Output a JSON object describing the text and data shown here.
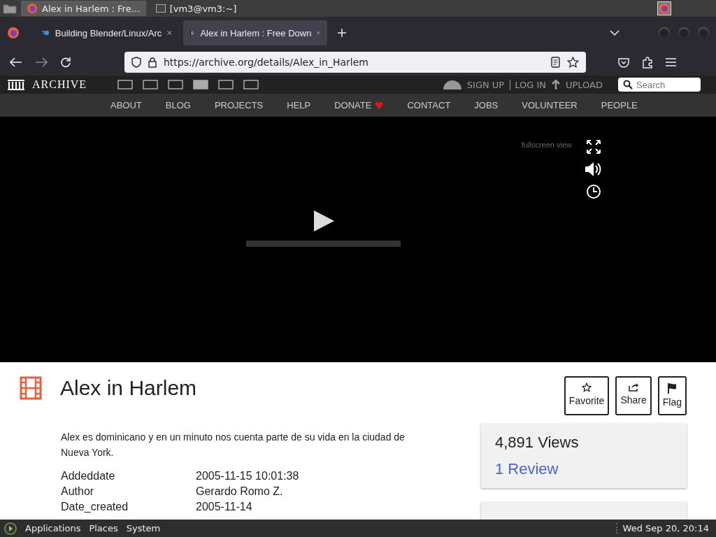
{
  "os_top_bar": {
    "windows": [
      {
        "title": "Alex in Harlem : Fre…",
        "kind": "browser",
        "selected": true
      },
      {
        "title": "[vm3@vm3:~]",
        "kind": "terminal",
        "selected": false
      }
    ]
  },
  "browser": {
    "tabs": [
      {
        "title": "Building Blender/Linux/Arc",
        "kind": "blender",
        "selected": false
      },
      {
        "title": "Alex in Harlem : Free Down",
        "kind": "archive",
        "selected": true
      }
    ],
    "url": "https://archive.org/details/Alex_in_Harlem"
  },
  "site_header": {
    "logo": "ARCHIVE",
    "account": [
      "SIGN UP",
      "LOG IN"
    ],
    "upload": "UPLOAD",
    "search": {
      "placeholder": "Search"
    },
    "nav": [
      {
        "label": "ABOUT"
      },
      {
        "label": "BLOG"
      },
      {
        "label": "PROJECTS"
      },
      {
        "label": "HELP"
      },
      {
        "label": "DONATE",
        "heart": true
      },
      {
        "label": "CONTACT"
      },
      {
        "label": "JOBS"
      },
      {
        "label": "VOLUNTEER"
      },
      {
        "label": "PEOPLE"
      }
    ]
  },
  "player": {
    "fullscreen_label": "fullscreen view"
  },
  "item": {
    "title": "Alex in Harlem",
    "actions": [
      {
        "label": "Favorite",
        "kind": "star"
      },
      {
        "label": "Share",
        "kind": "share"
      },
      {
        "label": "Flag",
        "kind": "flag"
      }
    ],
    "description": "Alex es dominicano y en un minuto nos cuenta parte de su vida en la ciudad de Nueva York.",
    "metadata": [
      {
        "key": "Addeddate",
        "value": "2005-11-15 10:01:38"
      },
      {
        "key": "Author",
        "value": "Gerardo Romo Z."
      },
      {
        "key": "Date_created",
        "value": "2005-11-14"
      }
    ],
    "views": "4,891 Views",
    "reviews": "1 Review"
  },
  "taskbar": {
    "menus": [
      "Applications",
      "Places",
      "System"
    ],
    "clock": "Wed Sep 20, 20:14"
  }
}
